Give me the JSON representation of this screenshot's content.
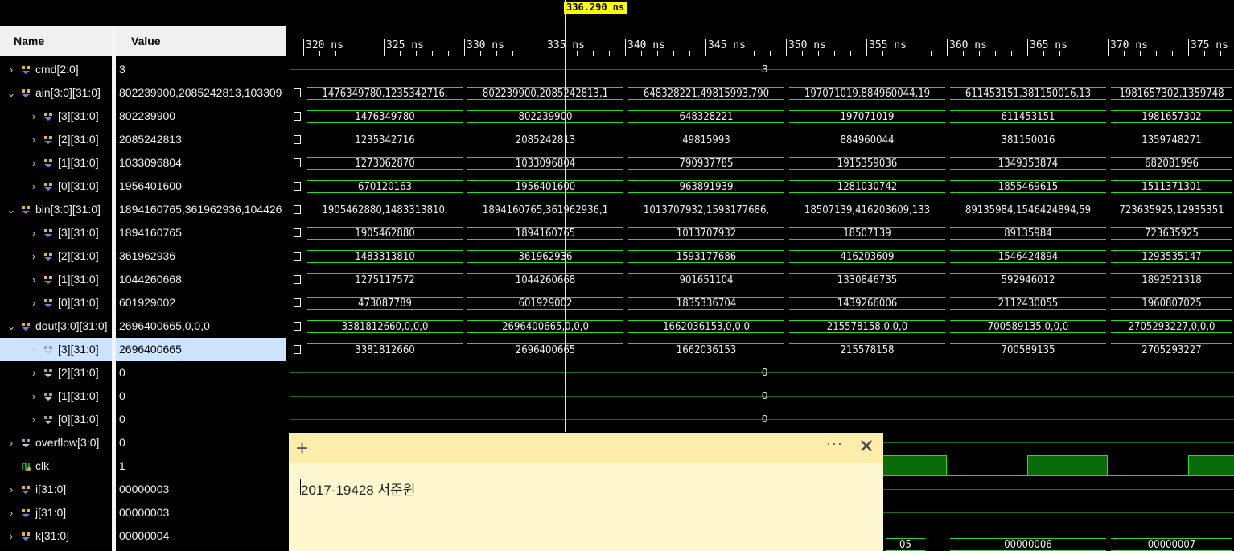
{
  "columns": {
    "name": "Name",
    "value": "Value"
  },
  "cursor": {
    "label": "336.290 ns"
  },
  "time_labels": [
    "320 ns",
    "325 ns",
    "330 ns",
    "335 ns",
    "340 ns",
    "345 ns",
    "350 ns",
    "355 ns",
    "360 ns",
    "365 ns",
    "370 ns",
    "375 ns"
  ],
  "signals": [
    {
      "name": "cmd[2:0]",
      "value": "3",
      "chevron": "›",
      "level": 0,
      "icon": "bus-icon"
    },
    {
      "name": "ain[3:0][31:0]",
      "value": "802239900,2085242813,103309",
      "chevron": "⌄",
      "level": 0,
      "icon": "bus-icon"
    },
    {
      "name": "[3][31:0]",
      "value": "802239900",
      "chevron": "›",
      "level": 1,
      "icon": "bus-icon"
    },
    {
      "name": "[2][31:0]",
      "value": "2085242813",
      "chevron": "›",
      "level": 1,
      "icon": "bus-icon"
    },
    {
      "name": "[1][31:0]",
      "value": "1033096804",
      "chevron": "›",
      "level": 1,
      "icon": "bus-icon"
    },
    {
      "name": "[0][31:0]",
      "value": "1956401600",
      "chevron": "›",
      "level": 1,
      "icon": "bus-icon"
    },
    {
      "name": "bin[3:0][31:0]",
      "value": "1894160765,361962936,104426",
      "chevron": "⌄",
      "level": 0,
      "icon": "bus-icon"
    },
    {
      "name": "[3][31:0]",
      "value": "1894160765",
      "chevron": "›",
      "level": 1,
      "icon": "bus-icon"
    },
    {
      "name": "[2][31:0]",
      "value": "361962936",
      "chevron": "›",
      "level": 1,
      "icon": "bus-icon"
    },
    {
      "name": "[1][31:0]",
      "value": "1044260668",
      "chevron": "›",
      "level": 1,
      "icon": "bus-icon"
    },
    {
      "name": "[0][31:0]",
      "value": "601929002",
      "chevron": "›",
      "level": 1,
      "icon": "bus-icon"
    },
    {
      "name": "dout[3:0][31:0]",
      "value": "2696400665,0,0,0",
      "chevron": "⌄",
      "level": 0,
      "icon": "bus-icon"
    },
    {
      "name": "[3][31:0]",
      "value": "2696400665",
      "chevron": "›",
      "level": 1,
      "icon": "bus-icon-gray",
      "selected": true
    },
    {
      "name": "[2][31:0]",
      "value": "0",
      "chevron": "›",
      "level": 1,
      "icon": "bus-icon-gray"
    },
    {
      "name": "[1][31:0]",
      "value": "0",
      "chevron": "›",
      "level": 1,
      "icon": "bus-icon-gray"
    },
    {
      "name": "[0][31:0]",
      "value": "0",
      "chevron": "›",
      "level": 1,
      "icon": "bus-icon-gray"
    },
    {
      "name": "overflow[3:0]",
      "value": "0",
      "chevron": "›",
      "level": 0,
      "icon": "bus-icon-gray"
    },
    {
      "name": "clk",
      "value": "1",
      "chevron": "",
      "level": 0,
      "icon": "wire-icon"
    },
    {
      "name": "i[31:0]",
      "value": "00000003",
      "chevron": "›",
      "level": 0,
      "icon": "bus-icon"
    },
    {
      "name": "j[31:0]",
      "value": "00000003",
      "chevron": "›",
      "level": 0,
      "icon": "bus-icon"
    },
    {
      "name": "k[31:0]",
      "value": "00000004",
      "chevron": "›",
      "level": 0,
      "icon": "bus-icon"
    }
  ],
  "waves": {
    "cmd": "3",
    "ain": [
      "1476349780,1235342716,",
      "802239900,2085242813,1",
      "648328221,49815993,790",
      "197071019,884960044,19",
      "611453151,381150016,13",
      "1981657302,1359748"
    ],
    "ain3": [
      "1476349780",
      "802239900",
      "648328221",
      "197071019",
      "611453151",
      "1981657302"
    ],
    "ain2": [
      "1235342716",
      "2085242813",
      "49815993",
      "884960044",
      "381150016",
      "1359748271"
    ],
    "ain1": [
      "1273062870",
      "1033096804",
      "790937785",
      "1915359036",
      "1349353874",
      "682081996"
    ],
    "ain0": [
      "670120163",
      "1956401600",
      "963891939",
      "1281030742",
      "1855469615",
      "1511371301"
    ],
    "bin": [
      "1905462880,1483313810,",
      "1894160765,361962936,1",
      "1013707932,1593177686,",
      "18507139,416203609,133",
      "89135984,1546424894,59",
      "723635925,12935351"
    ],
    "bin3": [
      "1905462880",
      "1894160765",
      "1013707932",
      "18507139",
      "89135984",
      "723635925"
    ],
    "bin2": [
      "1483313810",
      "361962936",
      "1593177686",
      "416203609",
      "1546424894",
      "1293535147"
    ],
    "bin1": [
      "1275117572",
      "1044260668",
      "901651104",
      "1330846735",
      "592946012",
      "1892521318"
    ],
    "bin0": [
      "473087789",
      "601929002",
      "1835336704",
      "1439266006",
      "2112430055",
      "1960807025"
    ],
    "dout": [
      "3381812660,0,0,0",
      "2696400665,0,0,0",
      "1662036153,0,0,0",
      "215578158,0,0,0",
      "700589135,0,0,0",
      "2705293227,0,0,0"
    ],
    "dout3": [
      "3381812660",
      "2696400665",
      "1662036153",
      "215578158",
      "700589135",
      "2705293227"
    ],
    "dout2": "0",
    "dout1": "0",
    "dout0": "0",
    "k_tail": [
      "05",
      "00000006",
      "00000007"
    ]
  },
  "note": {
    "text": "2017-19428 서준원",
    "plus": "+",
    "more": "···",
    "close": "✕"
  },
  "colors": {
    "wave": "#22dd22",
    "cursor": "#ffff00",
    "selection": "#cce4ff",
    "note_bg": "#fff7cf",
    "note_bar": "#fdedaa"
  }
}
